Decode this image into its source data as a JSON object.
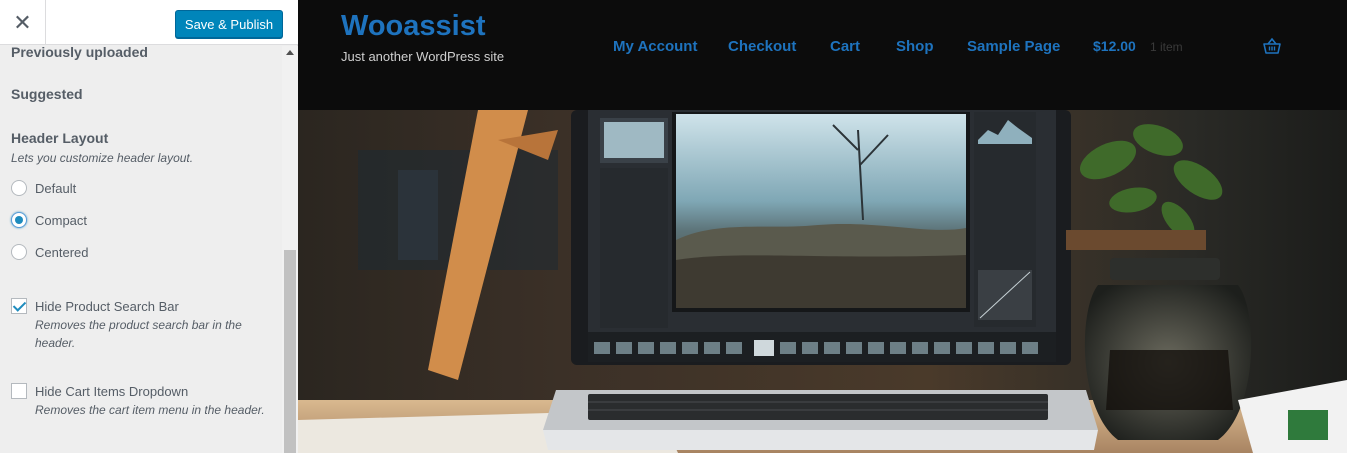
{
  "sidebar": {
    "close_icon": "close-icon",
    "publish_label": "Save & Publish",
    "sections": {
      "previously_uploaded": "Previously uploaded",
      "suggested": "Suggested"
    },
    "header_layout": {
      "title": "Header Layout",
      "description": "Lets you customize header layout.",
      "options": [
        {
          "label": "Default",
          "checked": false
        },
        {
          "label": "Compact",
          "checked": true
        },
        {
          "label": "Centered",
          "checked": false
        }
      ]
    },
    "hide_search": {
      "label": "Hide Product Search Bar",
      "description": "Removes the product search bar in the header.",
      "checked": true
    },
    "hide_cart": {
      "label": "Hide Cart Items Dropdown",
      "description": "Removes the cart item menu in the header.",
      "checked": false
    }
  },
  "site": {
    "title": "Wooassist",
    "tagline": "Just another WordPress site",
    "nav": [
      "My Account",
      "Checkout",
      "Cart",
      "Shop",
      "Sample Page"
    ],
    "cart_amount": "$12.00",
    "cart_count": "1 item",
    "cart_icon": "basket-icon",
    "hero_image": "laptop-photo-editing-hero-image"
  },
  "colors": {
    "accent": "#1e73be",
    "publish": "#0085ba",
    "header_bg": "#0c0c0c"
  }
}
